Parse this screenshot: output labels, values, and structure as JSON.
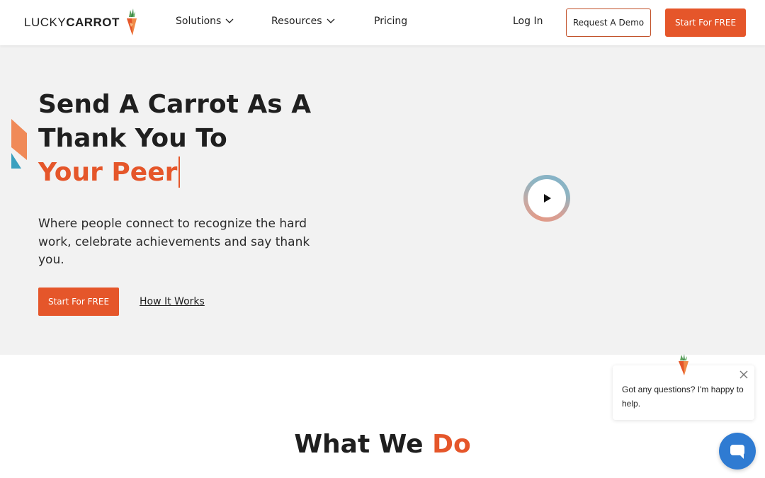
{
  "header": {
    "logo": {
      "text_light": "LUCKY",
      "text_bold": "CARROT"
    },
    "nav": [
      {
        "label": "Solutions",
        "has_dropdown": true
      },
      {
        "label": "Resources",
        "has_dropdown": true
      },
      {
        "label": "Pricing",
        "has_dropdown": false
      }
    ],
    "login_label": "Log In",
    "demo_label": "Request A Demo",
    "start_label": "Start For FREE"
  },
  "hero": {
    "headline_line1": "Send A Carrot As A",
    "headline_line2": "Thank You To",
    "headline_accent": "Your Peer",
    "subtext": "Where people connect to recognize the hard work, celebrate achievements and say thank you.",
    "cta_label": "Start For FREE",
    "link_label": "How It Works"
  },
  "section": {
    "title_main": "What We ",
    "title_accent": "Do"
  },
  "chat": {
    "message": "Got any questions? I'm happy to help."
  },
  "colors": {
    "accent": "#e5562a",
    "hero_bg": "#f2f2f2",
    "chat_blue": "#2f7bd2"
  }
}
